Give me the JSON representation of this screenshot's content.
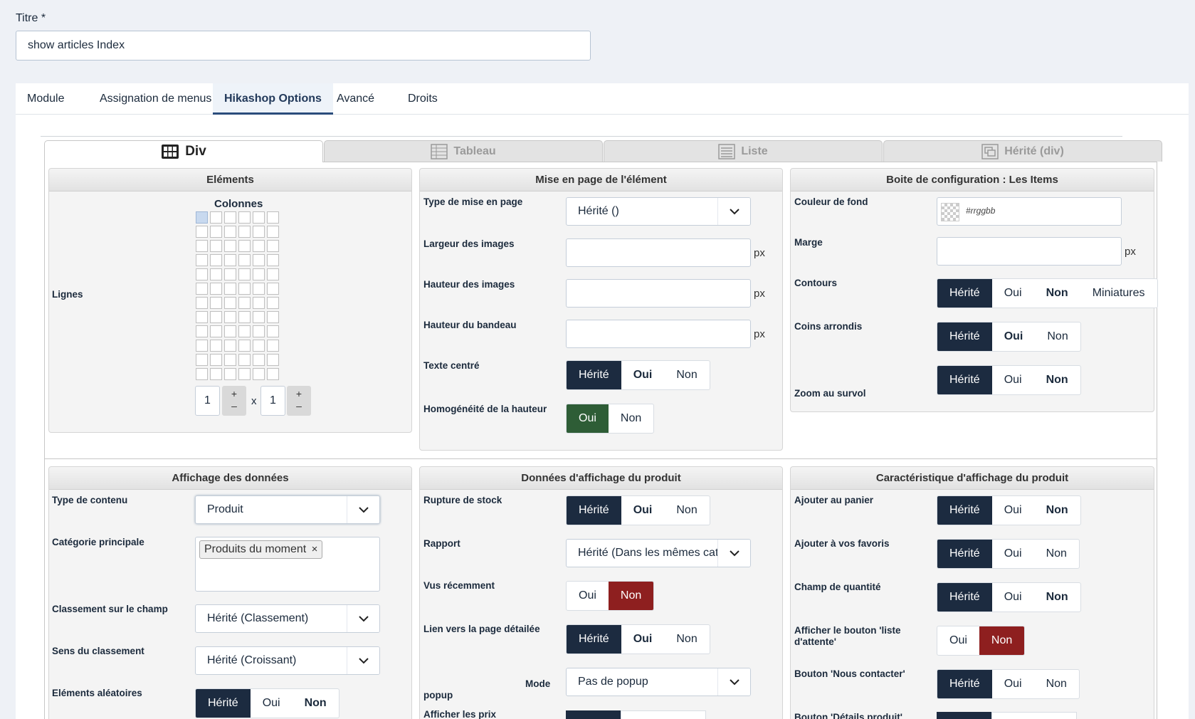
{
  "title_field": {
    "label": "Titre *",
    "value": "show articles Index"
  },
  "tabs": [
    {
      "label": "Module"
    },
    {
      "label": "Assignation de menus"
    },
    {
      "label": "Hikashop Options"
    },
    {
      "label": "Avancé"
    },
    {
      "label": "Droits"
    }
  ],
  "active_tab": "Hikashop Options",
  "view_tabs": [
    {
      "label": "Div",
      "icon": "div-grid-icon"
    },
    {
      "label": "Tableau",
      "icon": "table-icon"
    },
    {
      "label": "Liste",
      "icon": "list-icon"
    },
    {
      "label": "Hérité (div)",
      "icon": "inherit-icon"
    }
  ],
  "elements_panel": {
    "title": "Eléments",
    "columns_label": "Colonnes",
    "rows_label": "Lignes",
    "grid_cols": 6,
    "grid_rows": 12,
    "cols_value": "1",
    "rows_value": "1",
    "times": "x",
    "plus": "+",
    "minus": "–"
  },
  "layout_panel": {
    "title": "Mise en page de l'élément",
    "type_label": "Type de mise en page",
    "type_value": "Hérité ()",
    "img_width_label": "Largeur des images",
    "img_height_label": "Hauteur des images",
    "banner_height_label": "Hauteur du bandeau",
    "unit": "px",
    "center_text_label": "Texte centré",
    "center_text_options": [
      "Hérité",
      "Oui",
      "Non"
    ],
    "height_homog_label": "Homogénéité de la hauteur",
    "height_homog_options": [
      "Oui",
      "Non"
    ]
  },
  "config_panel": {
    "title": "Boite de configuration : Les Items",
    "bg_color_label": "Couleur de fond",
    "bg_color_placeholder": "#rrggbb",
    "margin_label": "Marge",
    "unit": "px",
    "borders_label": "Contours",
    "borders_options": [
      "Hérité",
      "Oui",
      "Non",
      "Miniatures"
    ],
    "rounded_label": "Coins arrondis",
    "rounded_options": [
      "Hérité",
      "Oui",
      "Non"
    ],
    "zoom_label": "Zoom au survol",
    "zoom_options": [
      "Hérité",
      "Oui",
      "Non"
    ]
  },
  "data_display_panel": {
    "title": "Affichage des données",
    "content_type_label": "Type de contenu",
    "content_type_value": "Produit",
    "main_category_label": "Catégorie principale",
    "main_category_tag": "Produits du moment",
    "tag_remove": "×",
    "sort_field_label": "Classement sur le champ",
    "sort_field_value": "Hérité (Classement)",
    "sort_dir_label": "Sens du classement",
    "sort_dir_value": "Hérité (Croissant)",
    "random_label": "Eléments aléatoires",
    "random_options": [
      "Hérité",
      "Oui",
      "Non"
    ]
  },
  "product_data_panel": {
    "title": "Données d'affichage du produit",
    "out_of_stock_label": "Rupture de stock",
    "out_of_stock_options": [
      "Hérité",
      "Oui",
      "Non"
    ],
    "report_label": "Rapport",
    "report_value": "Hérité (Dans les mêmes catégories)",
    "recently_viewed_label": "Vus récemment",
    "recently_viewed_options": [
      "Oui",
      "Non"
    ],
    "detail_link_label": "Lien vers la page détailée",
    "detail_link_options": [
      "Hérité",
      "Oui",
      "Non"
    ],
    "popup_mode_label_1": "Mode",
    "popup_mode_label_2": "popup",
    "popup_mode_value": "Pas de popup",
    "show_prices_label": "Afficher les prix"
  },
  "product_features_panel": {
    "title": "Caractéristique d'affichage du produit",
    "add_cart_label": "Ajouter au panier",
    "add_cart_options": [
      "Hérité",
      "Oui",
      "Non"
    ],
    "add_fav_label": "Ajouter à vos favoris",
    "add_fav_options": [
      "Hérité",
      "Oui",
      "Non"
    ],
    "qty_label": "Champ de quantité",
    "qty_options": [
      "Hérité",
      "Oui",
      "Non"
    ],
    "waitlist_label": "Afficher le bouton 'liste d'attente'",
    "waitlist_options": [
      "Oui",
      "Non"
    ],
    "contact_label": "Bouton 'Nous contacter'",
    "contact_options": [
      "Hérité",
      "Oui",
      "Non"
    ],
    "details_label": "Bouton 'Détails produit'"
  },
  "colors": {
    "dark": "#1c2b40",
    "green": "#2e5d36",
    "red": "#8e1f1f"
  }
}
